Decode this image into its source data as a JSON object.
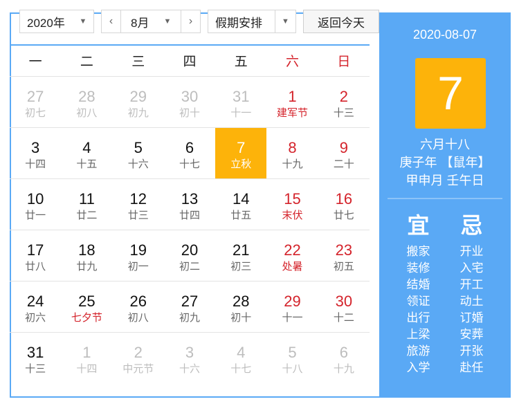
{
  "controls": {
    "year": "2020年",
    "prev_icon": "chevron-left-icon",
    "month": "8月",
    "next_icon": "chevron-right-icon",
    "holiday": "假期安排",
    "back": "返回今天"
  },
  "weekdays": [
    "一",
    "二",
    "三",
    "四",
    "五",
    "六",
    "日"
  ],
  "weeks": [
    [
      {
        "d": "27",
        "l": "初七",
        "o": true
      },
      {
        "d": "28",
        "l": "初八",
        "o": true
      },
      {
        "d": "29",
        "l": "初九",
        "o": true
      },
      {
        "d": "30",
        "l": "初十",
        "o": true
      },
      {
        "d": "31",
        "l": "十一",
        "o": true
      },
      {
        "d": "1",
        "l": "建军节",
        "f": true
      },
      {
        "d": "2",
        "l": "十三"
      }
    ],
    [
      {
        "d": "3",
        "l": "十四"
      },
      {
        "d": "4",
        "l": "十五"
      },
      {
        "d": "5",
        "l": "十六"
      },
      {
        "d": "6",
        "l": "十七"
      },
      {
        "d": "7",
        "l": "立秋",
        "s": true
      },
      {
        "d": "8",
        "l": "十九"
      },
      {
        "d": "9",
        "l": "二十"
      }
    ],
    [
      {
        "d": "10",
        "l": "廿一"
      },
      {
        "d": "11",
        "l": "廿二"
      },
      {
        "d": "12",
        "l": "廿三"
      },
      {
        "d": "13",
        "l": "廿四"
      },
      {
        "d": "14",
        "l": "廿五"
      },
      {
        "d": "15",
        "l": "末伏",
        "f": true
      },
      {
        "d": "16",
        "l": "廿七"
      }
    ],
    [
      {
        "d": "17",
        "l": "廿八"
      },
      {
        "d": "18",
        "l": "廿九"
      },
      {
        "d": "19",
        "l": "初一"
      },
      {
        "d": "20",
        "l": "初二"
      },
      {
        "d": "21",
        "l": "初三"
      },
      {
        "d": "22",
        "l": "处暑",
        "f": true
      },
      {
        "d": "23",
        "l": "初五"
      }
    ],
    [
      {
        "d": "24",
        "l": "初六"
      },
      {
        "d": "25",
        "l": "七夕节",
        "f": true
      },
      {
        "d": "26",
        "l": "初八"
      },
      {
        "d": "27",
        "l": "初九"
      },
      {
        "d": "28",
        "l": "初十"
      },
      {
        "d": "29",
        "l": "十一"
      },
      {
        "d": "30",
        "l": "十二"
      }
    ],
    [
      {
        "d": "31",
        "l": "十三"
      },
      {
        "d": "1",
        "l": "十四",
        "o": true
      },
      {
        "d": "2",
        "l": "中元节",
        "o": true
      },
      {
        "d": "3",
        "l": "十六",
        "o": true
      },
      {
        "d": "4",
        "l": "十七",
        "o": true
      },
      {
        "d": "5",
        "l": "十八",
        "o": true
      },
      {
        "d": "6",
        "l": "十九",
        "o": true
      }
    ]
  ],
  "side": {
    "date": "2020-08-07",
    "day": "7",
    "lunar": "六月十八",
    "year_gz": "庚子年 【鼠年】",
    "month_day_gz": "甲申月 壬午日",
    "yi_title": "宜",
    "yi": [
      "搬家",
      "装修",
      "结婚",
      "领证",
      "出行",
      "上梁",
      "旅游",
      "入学"
    ],
    "ji_title": "忌",
    "ji": [
      "开业",
      "入宅",
      "开工",
      "动土",
      "订婚",
      "安葬",
      "开张",
      "赴任"
    ]
  },
  "colors": {
    "accent": "#5aa9f5",
    "selected": "#fdb30a",
    "weekend": "#d4232b"
  }
}
